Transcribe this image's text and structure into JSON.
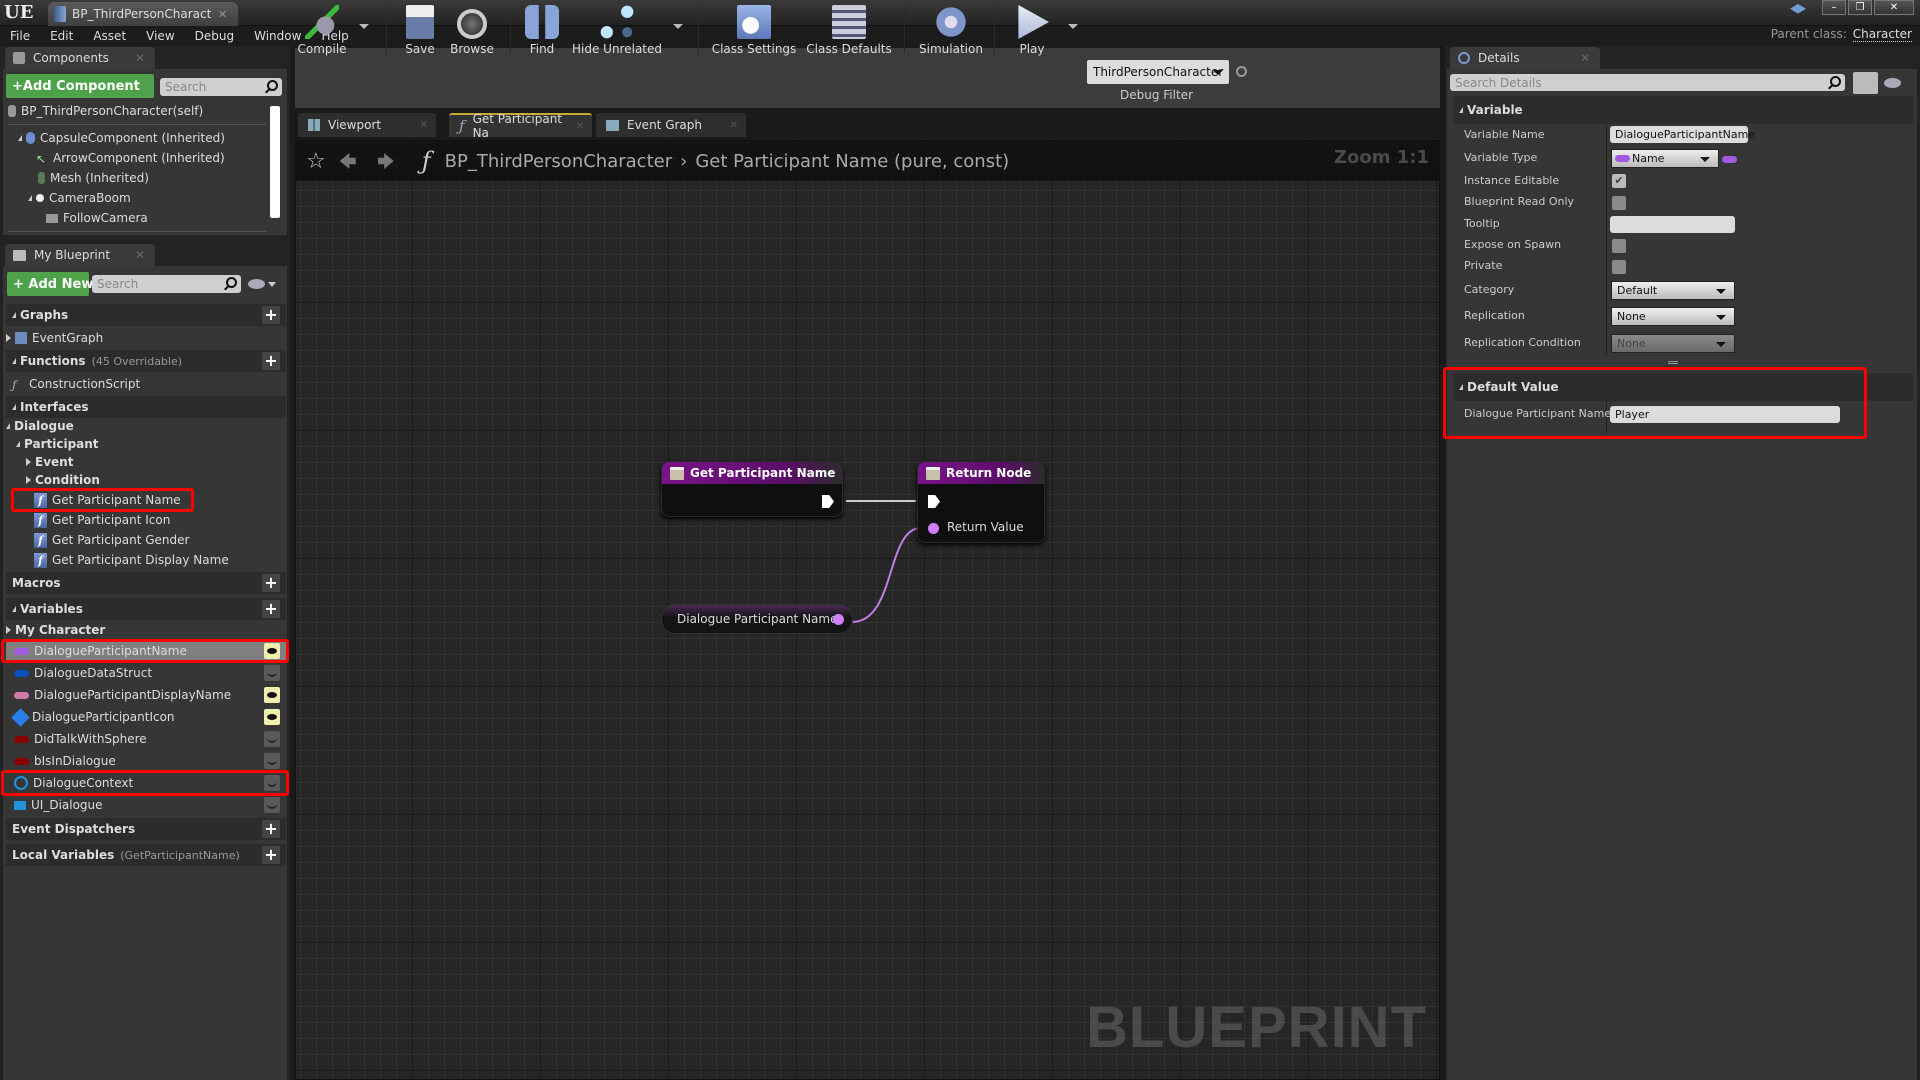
{
  "window": {
    "app_logo": "UE",
    "doc_tab": "BP_ThirdPersonCharacter",
    "controls": {
      "minimize": "–",
      "restore": "❐",
      "close": "✕"
    }
  },
  "menu": [
    "File",
    "Edit",
    "Asset",
    "View",
    "Debug",
    "Window",
    "Help"
  ],
  "parent_class": {
    "label": "Parent class:",
    "value": "Character"
  },
  "components": {
    "tab": "Components",
    "add_button": "+Add Component",
    "search_placeholder": "Search",
    "tree": [
      {
        "label": "BP_ThirdPersonCharacter(self)",
        "icon": "character-icon"
      },
      {
        "label": "CapsuleComponent (Inherited)",
        "icon": "capsule-icon"
      },
      {
        "label": "ArrowComponent (Inherited)",
        "icon": "arrow-icon"
      },
      {
        "label": "Mesh (Inherited)",
        "icon": "mesh-icon"
      },
      {
        "label": "CameraBoom",
        "icon": "spring-arm-icon"
      },
      {
        "label": "FollowCamera",
        "icon": "camera-icon"
      }
    ]
  },
  "my_blueprint": {
    "tab": "My Blueprint",
    "add_button": "+ Add New",
    "search_placeholder": "Search",
    "graphs_header": "Graphs",
    "graphs": [
      "EventGraph"
    ],
    "functions_header": "Functions",
    "functions_sub": "(45 Overridable)",
    "functions": [
      "ConstructionScript"
    ],
    "interfaces_header": "Interfaces",
    "interface_tree": {
      "root": "Dialogue",
      "group": "Participant",
      "collapsed": [
        "Event",
        "Condition"
      ],
      "items": [
        "Get Participant Name",
        "Get Participant Icon",
        "Get Participant Gender",
        "Get Participant Display Name"
      ]
    },
    "macros_header": "Macros",
    "variables_header": "Variables",
    "variable_category": "My Character",
    "variables": [
      {
        "name": "DialogueParticipantName",
        "color": "#a15ae0",
        "public": true,
        "selected": true
      },
      {
        "name": "DialogueDataStruct",
        "color": "#0b4fbf",
        "public": false
      },
      {
        "name": "DialogueParticipantDisplayName",
        "color": "#d07bab",
        "public": true
      },
      {
        "name": "DialogueParticipantIcon",
        "color": "#2a7ee8",
        "public": true
      },
      {
        "name": "DidTalkWithSphere",
        "color": "#8a0000",
        "public": false
      },
      {
        "name": "bIsInDialogue",
        "color": "#8a0000",
        "public": false
      },
      {
        "name": "DialogueContext",
        "color": "#1f93e0",
        "public": false
      },
      {
        "name": "UI_Dialogue",
        "color": "#1f93e0",
        "public": false
      }
    ],
    "dispatchers_header": "Event Dispatchers",
    "locals_header": "Local Variables",
    "locals_sub": "(GetParticipantName)"
  },
  "toolbar": {
    "buttons": [
      "Compile",
      "Save",
      "Browse",
      "Find",
      "Hide Unrelated",
      "Class Settings",
      "Class Defaults",
      "Simulation",
      "Play"
    ],
    "debug_object": "ThirdPersonCharacter",
    "debug_label": "Debug Filter"
  },
  "graph_tabs": [
    "Viewport",
    "Get Participant Na",
    "Event Graph"
  ],
  "graph": {
    "breadcrumb_root": "BP_ThirdPersonCharacter",
    "breadcrumb_sep": "›",
    "breadcrumb_leaf": "Get Participant Name (pure, const)",
    "zoom": "Zoom 1:1",
    "watermark": "BLUEPRINT",
    "nodes": {
      "entry": "Get Participant Name",
      "return": "Return Node",
      "return_pin": "Return Value",
      "variable": "Dialogue Participant Name"
    },
    "wire_color": "#c27de8"
  },
  "details": {
    "tab": "Details",
    "search_placeholder": "Search Details",
    "variable_section": "Variable",
    "rows": {
      "variable_name": {
        "label": "Variable Name",
        "value": "DialogueParticipantName"
      },
      "variable_type": {
        "label": "Variable Type",
        "value": "Name"
      },
      "instance_editable": {
        "label": "Instance Editable",
        "checked": true
      },
      "read_only": {
        "label": "Blueprint Read Only",
        "checked": false
      },
      "tooltip": {
        "label": "Tooltip",
        "value": ""
      },
      "expose_on_spawn": {
        "label": "Expose on Spawn",
        "checked": false
      },
      "private": {
        "label": "Private",
        "checked": false
      },
      "category": {
        "label": "Category",
        "value": "Default"
      },
      "replication": {
        "label": "Replication",
        "value": "None"
      },
      "replication_condition": {
        "label": "Replication Condition",
        "value": "None"
      }
    },
    "default_section": "Default Value",
    "default_row": {
      "label": "Dialogue Participant Name",
      "value": "Player"
    }
  },
  "colors": {
    "accent_green": "#4ea34a",
    "highlight_red": "#ff0000",
    "function_purple": "#7a138a"
  }
}
